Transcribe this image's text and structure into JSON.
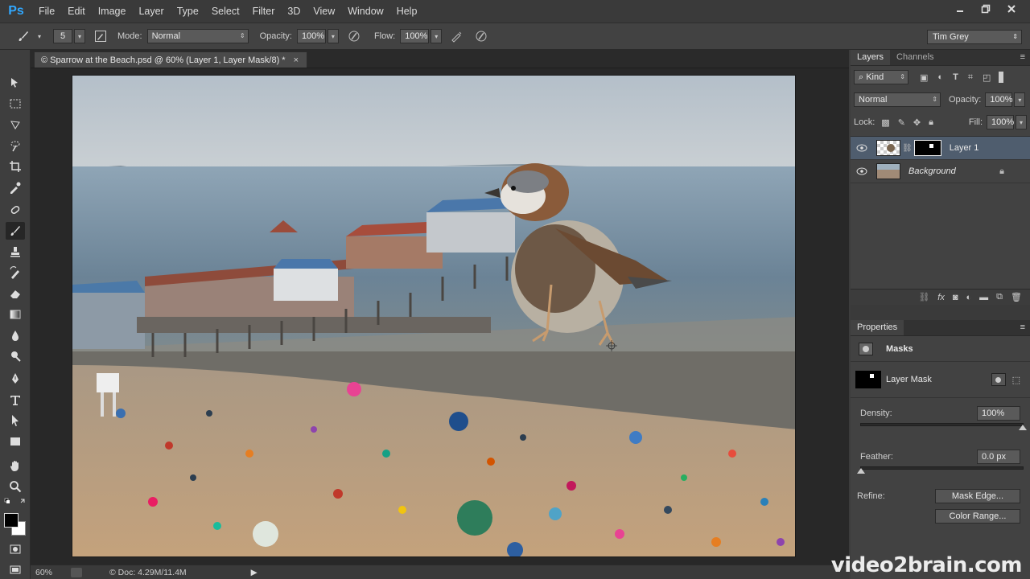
{
  "app": {
    "logo": "Ps",
    "menu": [
      "File",
      "Edit",
      "Image",
      "Layer",
      "Type",
      "Select",
      "Filter",
      "3D",
      "View",
      "Window",
      "Help"
    ],
    "accent": "#31a8ff"
  },
  "options": {
    "brush_size": "5",
    "mode_label": "Mode:",
    "mode_value": "Normal",
    "opacity_label": "Opacity:",
    "opacity_value": "100%",
    "flow_label": "Flow:",
    "flow_value": "100%",
    "workspace": "Tim Grey"
  },
  "document": {
    "tab_title": "© Sparrow at the Beach.psd @ 60% (Layer 1, Layer Mask/8) *",
    "close": "×"
  },
  "status": {
    "zoom": "60%",
    "doc_size": "© Doc: 4.29M/11.4M"
  },
  "layers_panel": {
    "tabs": [
      "Layers",
      "Channels"
    ],
    "filter_kind": "Kind",
    "blend_mode": "Normal",
    "opacity_label": "Opacity:",
    "opacity_value": "100%",
    "lock_label": "Lock:",
    "fill_label": "Fill:",
    "fill_value": "100%",
    "layers": [
      {
        "name": "Layer 1",
        "selected": true
      },
      {
        "name": "Background",
        "selected": false
      }
    ]
  },
  "properties_panel": {
    "title": "Properties",
    "section": "Masks",
    "mask_label": "Layer Mask",
    "density_label": "Density:",
    "density_value": "100%",
    "density_level": 1.0,
    "feather_label": "Feather:",
    "feather_value": "0.0 px",
    "feather_level": 0.0,
    "refine_label": "Refine:",
    "mask_edge_button": "Mask Edge...",
    "color_range_button": "Color Range..."
  },
  "watermark": "video2brain.com"
}
